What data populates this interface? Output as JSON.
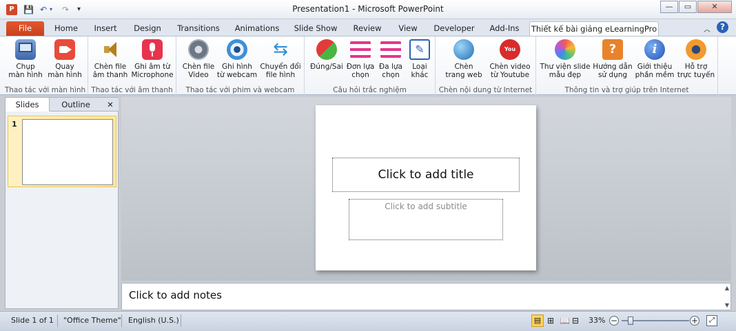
{
  "window": {
    "title": "Presentation1  -  Microsoft PowerPoint",
    "app_icon_letter": "P",
    "minimize": "—",
    "restore": "▭",
    "close": "✕"
  },
  "tabs": [
    {
      "label": "File"
    },
    {
      "label": "Home"
    },
    {
      "label": "Insert"
    },
    {
      "label": "Design"
    },
    {
      "label": "Transitions"
    },
    {
      "label": "Animations"
    },
    {
      "label": "Slide Show"
    },
    {
      "label": "Review"
    },
    {
      "label": "View"
    },
    {
      "label": "Developer"
    },
    {
      "label": "Add-Ins"
    },
    {
      "label": "Thiết kế bài giảng eLearningPro"
    }
  ],
  "ribbon": {
    "groups": [
      {
        "label": "Thao tác với màn hình",
        "buttons": [
          {
            "line1": "Chụp",
            "line2": "màn hình",
            "icon": "screenshot-icon"
          },
          {
            "line1": "Quay",
            "line2": "màn hình",
            "icon": "record-screen-icon"
          }
        ]
      },
      {
        "label": "Thao tác với âm thanh",
        "buttons": [
          {
            "line1": "Chèn file",
            "line2": "âm thanh",
            "icon": "speaker-icon"
          },
          {
            "line1": "Ghi âm từ",
            "line2": "Microphone",
            "icon": "microphone-icon"
          }
        ]
      },
      {
        "label": "Thao tác với phim và webcam",
        "buttons": [
          {
            "line1": "Chèn file",
            "line2": "Video",
            "icon": "film-reel-icon"
          },
          {
            "line1": "Ghi hình",
            "line2": "từ webcam",
            "icon": "webcam-icon"
          },
          {
            "line1": "Chuyển đổi",
            "line2": "file hình",
            "icon": "convert-arrows-icon"
          }
        ]
      },
      {
        "label": "Câu hỏi trắc nghiệm",
        "buttons": [
          {
            "line1": "Đúng/Sai",
            "line2": "",
            "icon": "true-false-icon"
          },
          {
            "line1": "Đơn lựa",
            "line2": "chọn",
            "icon": "single-choice-icon"
          },
          {
            "line1": "Đa lựa",
            "line2": "chọn",
            "icon": "multi-choice-icon"
          },
          {
            "line1": "Loại",
            "line2": "khác",
            "icon": "other-type-icon"
          }
        ]
      },
      {
        "label": "Chèn nội dung từ Internet",
        "buttons": [
          {
            "line1": "Chèn",
            "line2": "trang web",
            "icon": "globe-icon"
          },
          {
            "line1": "Chèn video",
            "line2": "từ Youtube",
            "icon": "youtube-icon"
          }
        ]
      },
      {
        "label": "Thông tin và trợ giúp trên Internet",
        "buttons": [
          {
            "line1": "Thư viện slide",
            "line2": "mẫu đẹp",
            "icon": "slide-library-icon"
          },
          {
            "line1": "Hướng dẫn",
            "line2": "sử dụng",
            "icon": "user-guide-icon"
          },
          {
            "line1": "Giới thiệu",
            "line2": "phần mềm",
            "icon": "info-icon"
          },
          {
            "line1": "Hỗ trợ",
            "line2": "trực tuyến",
            "icon": "online-support-icon"
          }
        ]
      }
    ]
  },
  "left_pane": {
    "tabs": [
      "Slides",
      "Outline"
    ],
    "close": "✕",
    "slide_number": "1"
  },
  "slide": {
    "title_placeholder": "Click to add title",
    "subtitle_placeholder": "Click to add subtitle"
  },
  "notes": {
    "placeholder": "Click to add notes"
  },
  "status": {
    "slide_info": "Slide 1 of 1",
    "theme": "\"Office Theme\"",
    "language": "English (U.S.)",
    "zoom": "33%",
    "zoom_level": 0.33
  },
  "colors": {
    "file_tab": "#d24726",
    "accent_blue": "#3a5a9a"
  }
}
